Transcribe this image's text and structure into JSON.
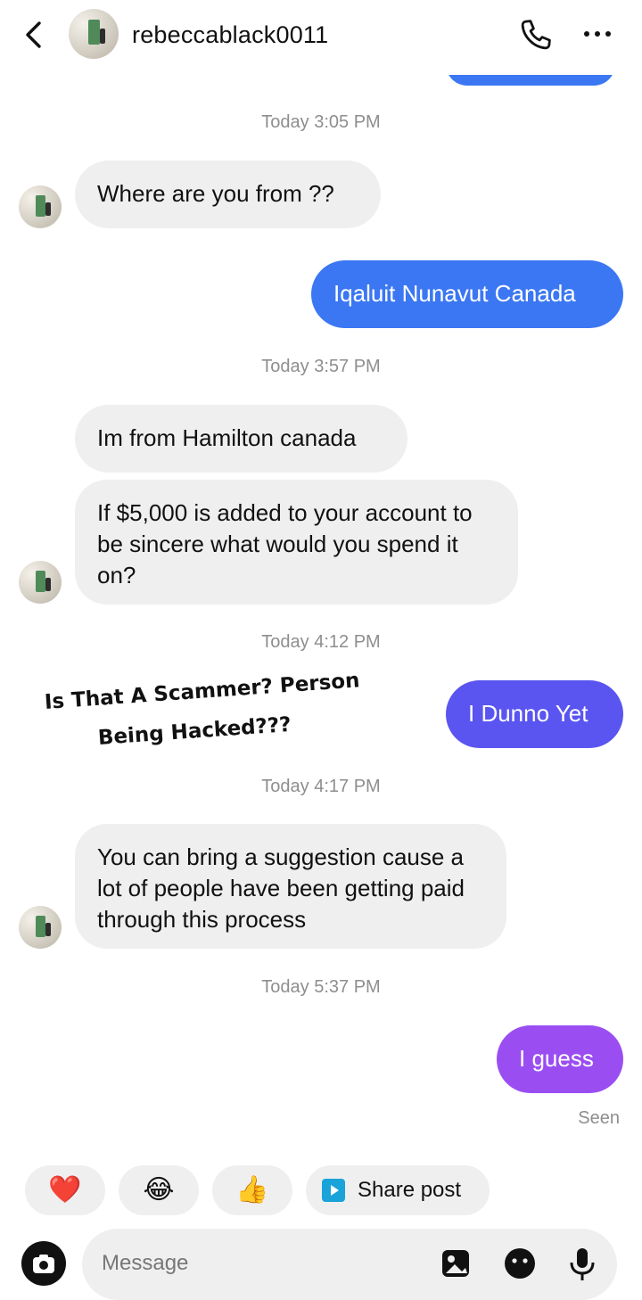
{
  "header": {
    "username": "rebeccablack0011"
  },
  "thread": {
    "timestamps": [
      "Today 3:05 PM",
      "Today 3:57 PM",
      "Today 4:12 PM",
      "Today 4:17 PM",
      "Today 5:37 PM"
    ],
    "messages": [
      {
        "from": "them",
        "text": "Where are you from ??"
      },
      {
        "from": "me",
        "text": "Iqaluit Nunavut Canada"
      },
      {
        "from": "them",
        "text": "Im from Hamilton canada"
      },
      {
        "from": "them",
        "text": "If $5,000 is added to your account to be sincere what would you spend it on?"
      },
      {
        "from": "me",
        "text": "I Dunno Yet"
      },
      {
        "from": "them",
        "text": "You can bring a suggestion cause a lot of people have been getting paid through this process"
      },
      {
        "from": "me",
        "text": "I guess"
      }
    ],
    "overlay_caption": {
      "line1": "Is That A Scammer? Person",
      "line2": "Being Hacked???"
    },
    "seen_label": "Seen"
  },
  "quick_reactions": {
    "items": [
      "❤️",
      "😂",
      "👍"
    ],
    "share_label": "Share post"
  },
  "composer": {
    "placeholder": "Message"
  },
  "colors": {
    "sent_blue": "#3b77f3",
    "sent_indigo": "#5a55f0",
    "sent_purple": "#9a4ef2",
    "received_bg": "#efefef",
    "meta_gray": "#8e8e8e"
  }
}
